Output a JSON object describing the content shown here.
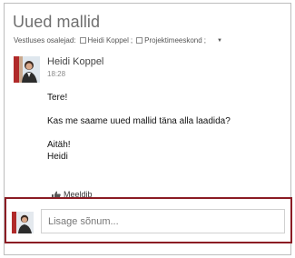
{
  "conversation": {
    "title": "Uued mallid",
    "participants_label": "Vestluses osalejad:",
    "participants": [
      "Heidi Koppel",
      "Projektimeeskond"
    ],
    "dropdown_glyph": "▼"
  },
  "message": {
    "sender": "Heidi Koppel",
    "time": "18:28",
    "lines": {
      "greeting": "Tere!",
      "question": "Kas me saame uued mallid täna alla laadida?",
      "thanks": "Aitäh!",
      "signature": "Heidi"
    },
    "like_label": "Meeldib",
    "like_icon": "thumbs-up-icon"
  },
  "reply": {
    "placeholder": "Lisage sõnum..."
  },
  "colors": {
    "accent_border": "#8b1c24",
    "title_text": "#6f6f6f"
  }
}
